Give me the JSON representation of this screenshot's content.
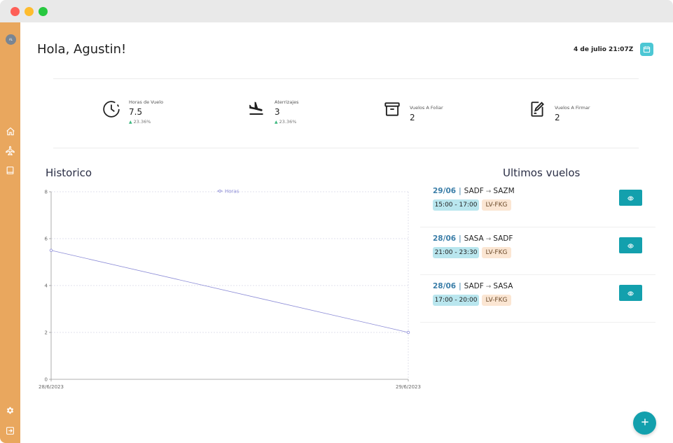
{
  "header": {
    "greeting": "Hola, Agustin!",
    "datetime": "4 de julio 21:07Z",
    "avatar_initials": "AL"
  },
  "stats": [
    {
      "label": "Horas de Vuelo",
      "value": "7.5",
      "delta": "23.36%",
      "icon": "clock-icon"
    },
    {
      "label": "Aterrizajes",
      "value": "3",
      "delta": "23.36%",
      "icon": "plane-landing-icon"
    },
    {
      "label": "Vuelos A Foliar",
      "value": "2",
      "icon": "archive-box-icon"
    },
    {
      "label": "Vuelos A Firmar",
      "value": "2",
      "icon": "sign-document-icon"
    }
  ],
  "historico": {
    "title": "Historico"
  },
  "chart_data": {
    "type": "line",
    "title": "",
    "x": [
      "28/6/2023",
      "29/6/2023"
    ],
    "series": [
      {
        "name": "Horas",
        "values": [
          5.5,
          2
        ],
        "color": "#8a8ad6"
      }
    ],
    "ylim": [
      0,
      8
    ],
    "yticks": [
      "0",
      "2",
      "4",
      "6",
      "8"
    ],
    "grid": true,
    "legend": "top-center",
    "xlabel": "",
    "ylabel": ""
  },
  "ultimos": {
    "title": "Ultimos vuelos",
    "flights": [
      {
        "date": "29/06",
        "from": "SADF",
        "to": "SAZM",
        "time": "15:00 - 17:00",
        "reg": "LV-FKG"
      },
      {
        "date": "28/06",
        "from": "SASA",
        "to": "SADF",
        "time": "21:00 - 23:30",
        "reg": "LV-FKG"
      },
      {
        "date": "28/06",
        "from": "SADF",
        "to": "SASA",
        "time": "17:00 - 20:00",
        "reg": "LV-FKG"
      }
    ]
  },
  "colors": {
    "sidebar": "#e9a75e",
    "accent": "#13a0ad",
    "calendar": "#4cc7d4",
    "time_pill": "#b9e6ee",
    "reg_pill": "#fbe6d3",
    "delta_up": "#3bb77e"
  }
}
